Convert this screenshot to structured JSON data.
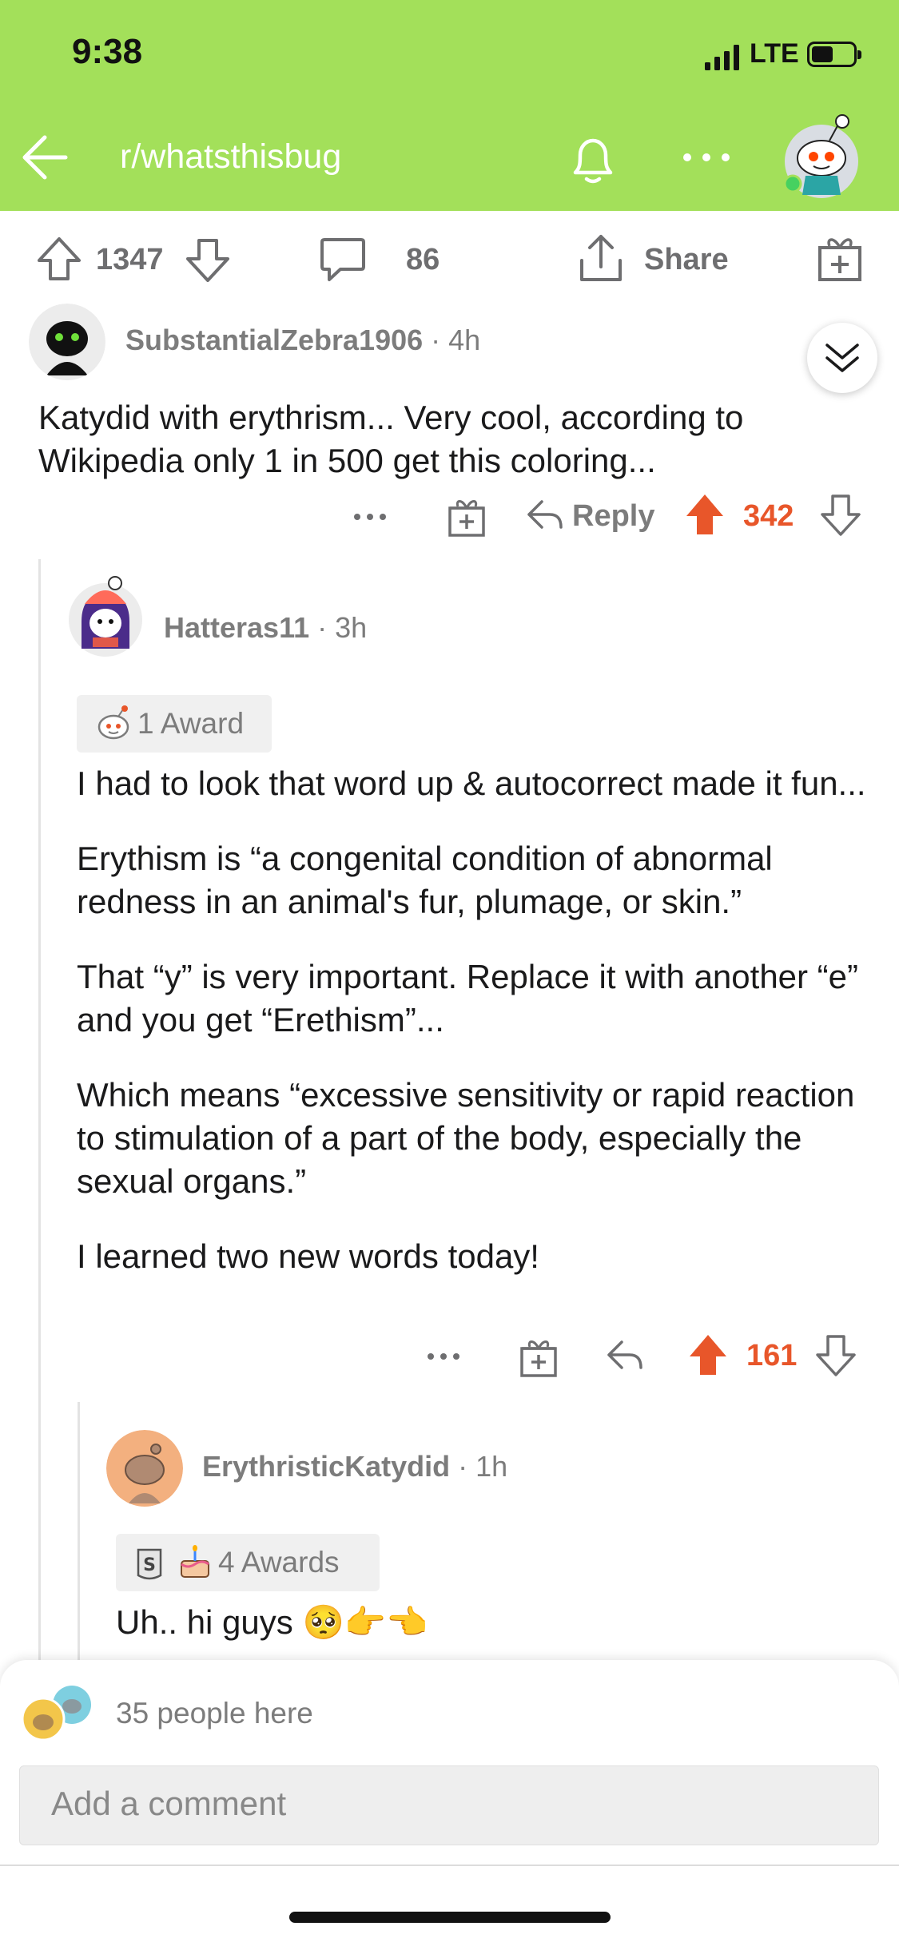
{
  "status": {
    "time": "9:38",
    "network": "LTE"
  },
  "header": {
    "subreddit": "r/whatsthisbug"
  },
  "post_bar": {
    "upvotes": "1347",
    "comments": "86",
    "share_label": "Share"
  },
  "comments": [
    {
      "username": "SubstantialZebra1906",
      "age": "· 4h",
      "body": [
        "Katydid with erythrism... Very cool, according to Wikipedia only 1 in 500 get this coloring..."
      ],
      "reply_label": "Reply",
      "score": "342"
    },
    {
      "username": "Hatteras11",
      "age": "· 3h",
      "awards": "1 Award",
      "body": [
        "I had to look that word up & autocorrect made it fun...",
        "Erythism is “a congenital condition of abnormal redness in an animal's fur, plumage, or skin.”",
        "That “y” is very important. Replace it with another “e” and you get “Erethism”...",
        "Which means “excessive sensitivity or rapid reaction to stimulation of a part of the body, especially the sexual organs.”",
        "I learned two new words today!"
      ],
      "score": "161"
    },
    {
      "username": "ErythristicKatydid",
      "age": "· 1h",
      "awards": "4 Awards",
      "body": [
        "Uh.. hi guys 🥺👉👈"
      ]
    }
  ],
  "composer": {
    "people_here": "35 people here",
    "placeholder": "Add a comment"
  },
  "colors": {
    "header_bg": "#a3e05a",
    "upvote_active": "#e8562a",
    "meta_text": "#7c7c7c"
  }
}
